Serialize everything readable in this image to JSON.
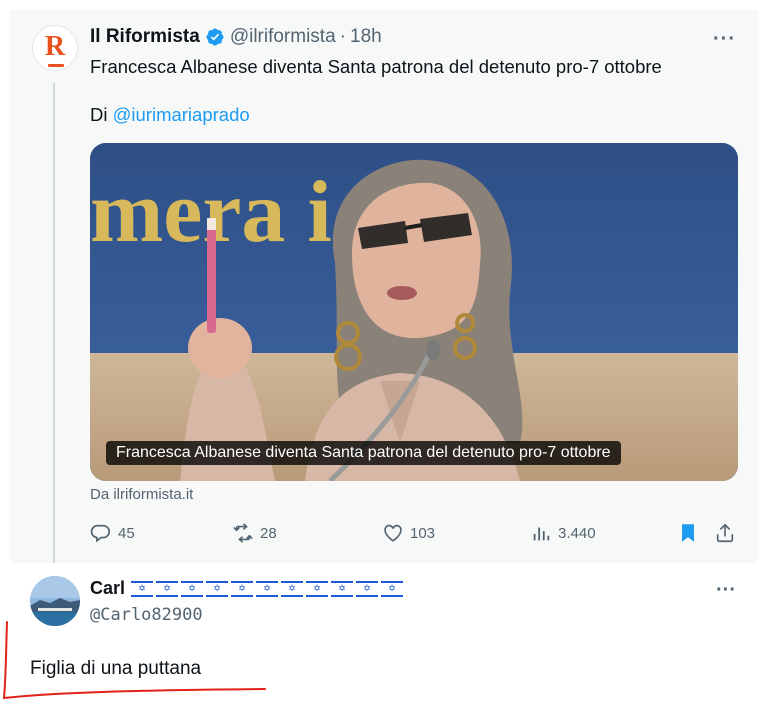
{
  "tweet": {
    "author_name": "Il Riformista",
    "author_handle": "@ilriformista",
    "separator": "·",
    "time": "18h",
    "more_icon": "more-icon",
    "text": "Francesca Albanese diventa Santa patrona del detenuto pro-7 ottobre",
    "byline_prefix": "Di",
    "byline_mention": "@iurimariaprado",
    "card": {
      "background_text": "mera  i dep",
      "caption": "Francesca Albanese diventa Santa patrona del detenuto pro-7 ottobre",
      "source": "Da ilriformista.it"
    },
    "actions": {
      "replies": "45",
      "retweets": "28",
      "likes": "103",
      "views": "3.440"
    },
    "accent_color": "#1d9bf0",
    "logo_color": "#e8521f"
  },
  "reply": {
    "author_name": "Carl",
    "flag_count_label": "11 flags of Israel",
    "flags": [
      "✡",
      "✡",
      "✡",
      "✡",
      "✡",
      "✡",
      "✡",
      "✡",
      "✡",
      "✡",
      "✡"
    ],
    "author_handle": "@Carlo82900",
    "text": "Figlia di una puttana"
  }
}
